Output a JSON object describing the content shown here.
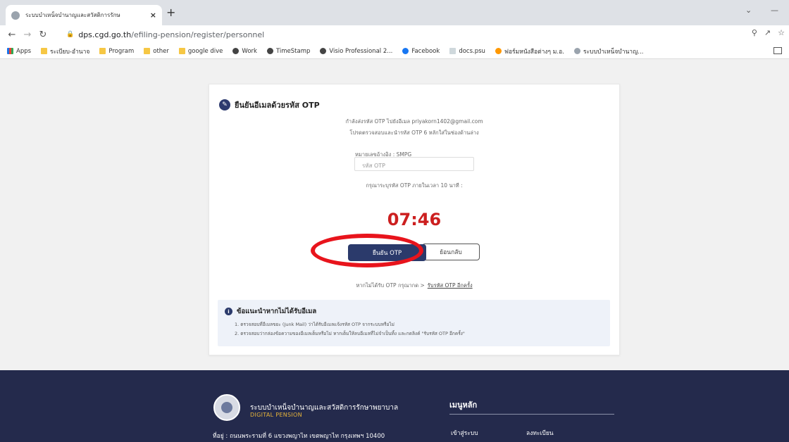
{
  "browser": {
    "tab_title": "ระบบบำเหน็จบำนาญและสวัสดิการรักษ",
    "tab_close": "×",
    "new_tab": "+",
    "url_host": "dps.cgd.go.th",
    "url_path": "/efiling-pension/register/personnel",
    "bookmarks": [
      {
        "label": "Apps",
        "icon": "apps-grid-icon"
      },
      {
        "label": "ระเบียบ-อำนาจ",
        "icon": "folder-icon"
      },
      {
        "label": "Program",
        "icon": "folder-icon"
      },
      {
        "label": "other",
        "icon": "folder-icon"
      },
      {
        "label": "google dive",
        "icon": "folder-icon"
      },
      {
        "label": "Work",
        "icon": "globe-icon"
      },
      {
        "label": "TimeStamp",
        "icon": "globe-icon"
      },
      {
        "label": "Visio Professional 2...",
        "icon": "globe-icon"
      },
      {
        "label": "Facebook",
        "icon": "facebook-icon"
      },
      {
        "label": "docs.psu",
        "icon": "doc-icon"
      },
      {
        "label": "ฟอร์มหนังสือต่างๆ ม.อ.",
        "icon": "psu-icon"
      },
      {
        "label": "ระบบบำเหน็จบำนาญ...",
        "icon": "site-icon"
      }
    ]
  },
  "card": {
    "title": "ยืนยันอีเมลด้วยรหัส OTP",
    "sent_line": "กำลังส่งรหัส OTP ไปยังอีเมล priyakorn1402@gmail.com",
    "check_line": "โปรดตรวจสอบและนำรหัส OTP 6 หลักใส่ในช่องด้านล่าง",
    "ref_label": "หมายเลขอ้างอิง : SMPG",
    "otp_placeholder": "รหัส OTP",
    "time_hint": "กรุณาระบุรหัส OTP ภายในเวลา 10 นาที :",
    "timer": "07:46",
    "confirm_button": "ยืนยัน OTP",
    "back_button": "ย้อนกลับ",
    "resend_prefix": "หากไม่ได้รับ OTP กรุณากด >",
    "resend_link": "รับรหัส OTP อีกครั้ง"
  },
  "advice": {
    "title": "ข้อแนะนำหากไม่ได้รับอีเมล",
    "item1": "1. ตรวจสอบที่อีเมลขยะ (Junk Mail) ว่าได้รับอีเมลแจ้งรหัส OTP จากระบบหรือไม่",
    "item2": "2. ตรวจสอบว่ากล่องข้อความของอีเมลเต็มหรือไม่ หากเต็มให้ลบอีเมลที่ไม่จำเป็นทิ้ง และกดลิงค์ \"รับรหัส OTP อีกครั้ง\""
  },
  "footer": {
    "org_name": "ระบบบำเหน็จบำนาญและสวัสดิการรักษาพยาบาล",
    "org_sub": "DIGITAL PENSION",
    "address": "ที่อยู่ : ถนนพระรามที่ 6 แขวงพญาไท เขตพญาไท กรุงเทพฯ 10400",
    "menu_title": "เมนูหลัก",
    "link_login": "เข้าสู่ระบบ",
    "link_register": "ลงทะเบียน"
  },
  "colors": {
    "accent": "#2b3a6b",
    "timer": "#cc1f1f",
    "annotation_ring": "#e8141c",
    "footer_bg": "#242a4c"
  }
}
